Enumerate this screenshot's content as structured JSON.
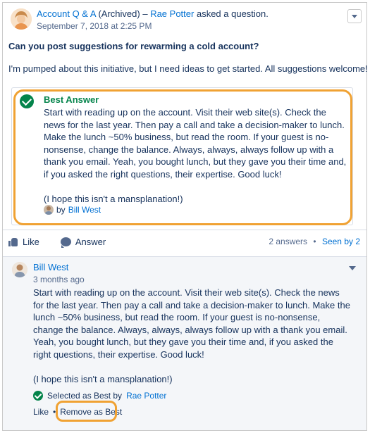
{
  "header": {
    "group_link": "Account Q & A",
    "archived": "(Archived)",
    "separator": "–",
    "author": "Rae Potter",
    "action": "asked a question.",
    "date": "September 7, 2018 at 2:25 PM"
  },
  "question": {
    "title": "Can you post suggestions for rewarming a cold account?",
    "body": "I'm pumped about this initiative, but I need ideas to get started. All suggestions welcome!"
  },
  "best_answer": {
    "label": "Best Answer",
    "paragraph1": "Start with reading up on the account. Visit their web site(s). Check the news for the last year. Then pay a call and take a decision-maker to lunch. Make the lunch ~50% business, but read the room. If your guest is no-nonsense, change the balance. Always, always, always follow up with a thank you email. Yeah, you bought lunch, but they gave you their time and, if you asked the right questions, their expertise. Good luck!",
    "paragraph2": "(I hope this isn't a mansplanation!)",
    "by_prefix": "by",
    "by_name": "Bill West"
  },
  "actions": {
    "like": "Like",
    "answer": "Answer",
    "answer_count": "2 answers",
    "dot": "•",
    "seen_by": "Seen by 2"
  },
  "answer": {
    "author": "Bill West",
    "time": "3 months ago",
    "paragraph1": "Start with reading up on the account. Visit their web site(s). Check the news for the last year. Then pay a call and take a decision-maker to lunch. Make the lunch ~50% business, but read the room. If your guest is no-nonsense, change the balance. Always, always, always follow up with a thank you email. Yeah, you bought lunch, but they gave you their time and, if you asked the right questions, their expertise. Good luck!",
    "paragraph2": "(I hope this isn't a mansplanation!)",
    "selected_prefix": "Selected as Best by",
    "selected_by": "Rae Potter",
    "like": "Like",
    "dot": "•",
    "remove_best": "Remove as Best"
  },
  "colors": {
    "link": "#0070d2",
    "best_green": "#04844b",
    "highlight_orange": "#f0a233",
    "text": "#16325c"
  }
}
